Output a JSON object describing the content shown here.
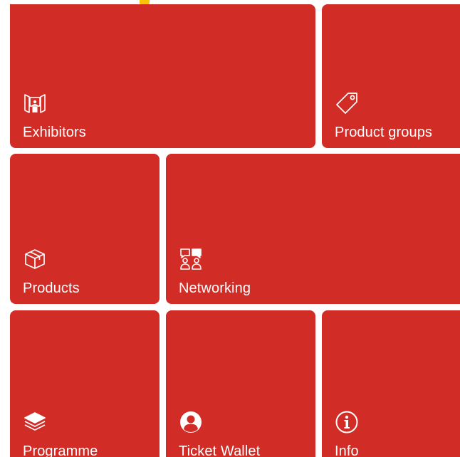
{
  "theme": {
    "tile_color": "#d22c27",
    "accent_color": "#f7c600",
    "text_color": "#ffffff"
  },
  "tiles": [
    {
      "id": "exhibitors",
      "label": "Exhibitors",
      "icon": "exhibitor-booth-icon"
    },
    {
      "id": "product-groups",
      "label": "Product groups",
      "icon": "tag-icon"
    },
    {
      "id": "products",
      "label": "Products",
      "icon": "box-icon"
    },
    {
      "id": "networking",
      "label": "Networking",
      "icon": "networking-chat-icon"
    },
    {
      "id": "programme",
      "label": "Programme",
      "icon": "layers-icon"
    },
    {
      "id": "ticket-wallet",
      "label": "Ticket Wallet",
      "icon": "user-circle-icon"
    },
    {
      "id": "info",
      "label": "Info",
      "icon": "info-icon"
    }
  ]
}
